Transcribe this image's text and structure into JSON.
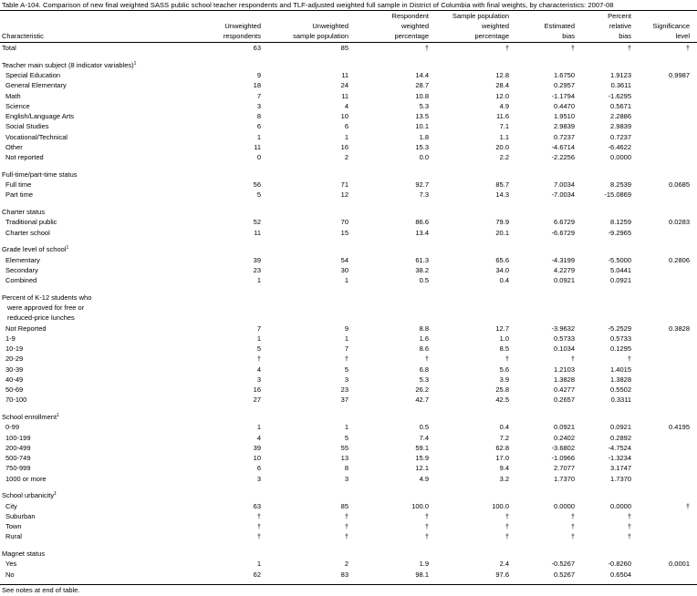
{
  "title": "Table A-104. Comparison of new final weighted SASS public school teacher respondents and TLF-adjusted weighted full sample in District of Columbia with final weights, by characteristics: 2007-08",
  "headers": {
    "characteristic": [
      "Characteristic"
    ],
    "unweighted_respondents": [
      "Unweighted",
      "respondents"
    ],
    "unweighted_sample": [
      "Unweighted",
      "sample population"
    ],
    "respondent_pct": [
      "Respondent",
      "weighted",
      "percentage"
    ],
    "sample_pct": [
      "Sample population",
      "weighted",
      "percentage"
    ],
    "est_bias": [
      "Estimated",
      "bias"
    ],
    "pct_rel_bias": [
      "Percent",
      "relative",
      "bias"
    ],
    "significance": [
      "Significance",
      "level"
    ]
  },
  "rows": [
    {
      "t": "data",
      "label": "Total",
      "indent": 0,
      "v": [
        "63",
        "85",
        "†",
        "†",
        "†",
        "†",
        "†"
      ]
    },
    {
      "t": "gap"
    },
    {
      "t": "section",
      "label": "Teacher main subject (8 indicator variables)",
      "sup": "1"
    },
    {
      "t": "data",
      "label": "Special Education",
      "indent": 1,
      "v": [
        "9",
        "11",
        "14.4",
        "12.8",
        "1.6750",
        "1.9123",
        "0.9987"
      ]
    },
    {
      "t": "data",
      "label": "General Elementary",
      "indent": 1,
      "v": [
        "18",
        "24",
        "28.7",
        "28.4",
        "0.2957",
        "0.3611",
        ""
      ]
    },
    {
      "t": "data",
      "label": "Math",
      "indent": 1,
      "v": [
        "7",
        "11",
        "10.8",
        "12.0",
        "-1.1794",
        "-1.6295",
        ""
      ]
    },
    {
      "t": "data",
      "label": "Science",
      "indent": 1,
      "v": [
        "3",
        "4",
        "5.3",
        "4.9",
        "0.4470",
        "0.5671",
        ""
      ]
    },
    {
      "t": "data",
      "label": "English/Language Arts",
      "indent": 1,
      "v": [
        "8",
        "10",
        "13.5",
        "11.6",
        "1.9510",
        "2.2886",
        ""
      ]
    },
    {
      "t": "data",
      "label": "Social Studies",
      "indent": 1,
      "v": [
        "6",
        "6",
        "10.1",
        "7.1",
        "2.9839",
        "2.9839",
        ""
      ]
    },
    {
      "t": "data",
      "label": "Vocational/Technical",
      "indent": 1,
      "v": [
        "1",
        "1",
        "1.8",
        "1.1",
        "0.7237",
        "0.7237",
        ""
      ]
    },
    {
      "t": "data",
      "label": "Other",
      "indent": 1,
      "v": [
        "11",
        "16",
        "15.3",
        "20.0",
        "-4.6714",
        "-6.4622",
        ""
      ]
    },
    {
      "t": "data",
      "label": "Not reported",
      "indent": 1,
      "v": [
        "0",
        "2",
        "0.0",
        "2.2",
        "-2.2256",
        "0.0000",
        ""
      ]
    },
    {
      "t": "gap"
    },
    {
      "t": "section",
      "label": "Full-time/part-time status"
    },
    {
      "t": "data",
      "label": "Full time",
      "indent": 1,
      "v": [
        "56",
        "71",
        "92.7",
        "85.7",
        "7.0034",
        "8.2539",
        "0.0685"
      ]
    },
    {
      "t": "data",
      "label": "Part time",
      "indent": 1,
      "v": [
        "5",
        "12",
        "7.3",
        "14.3",
        "-7.0034",
        "-15.0869",
        ""
      ]
    },
    {
      "t": "gap"
    },
    {
      "t": "section",
      "label": "Charter status"
    },
    {
      "t": "data",
      "label": "Traditional public",
      "indent": 1,
      "v": [
        "52",
        "70",
        "86.6",
        "79.9",
        "6.6729",
        "8.1259",
        "0.0283"
      ]
    },
    {
      "t": "data",
      "label": "Charter school",
      "indent": 1,
      "v": [
        "11",
        "15",
        "13.4",
        "20.1",
        "-6.6729",
        "-9.2965",
        ""
      ]
    },
    {
      "t": "gap"
    },
    {
      "t": "section",
      "label": "Grade level of school",
      "sup": "1"
    },
    {
      "t": "data",
      "label": "Elementary",
      "indent": 1,
      "v": [
        "39",
        "54",
        "61.3",
        "65.6",
        "-4.3199",
        "-5.5000",
        "0.2806"
      ]
    },
    {
      "t": "data",
      "label": "Secondary",
      "indent": 1,
      "v": [
        "23",
        "30",
        "38.2",
        "34.0",
        "4.2279",
        "5.0441",
        ""
      ]
    },
    {
      "t": "data",
      "label": "Combined",
      "indent": 1,
      "v": [
        "1",
        "1",
        "0.5",
        "0.4",
        "0.0921",
        "0.0921",
        ""
      ]
    },
    {
      "t": "gap"
    },
    {
      "t": "section",
      "label": "Percent of K-12 students who"
    },
    {
      "t": "section",
      "label": "were approved for free or",
      "indent": 2
    },
    {
      "t": "section",
      "label": "reduced-price lunches",
      "indent": 2
    },
    {
      "t": "data",
      "label": "Not Reported",
      "indent": 1,
      "v": [
        "7",
        "9",
        "8.8",
        "12.7",
        "-3.9632",
        "-5.2529",
        "0.3828"
      ]
    },
    {
      "t": "data",
      "label": "1-9",
      "indent": 1,
      "v": [
        "1",
        "1",
        "1.6",
        "1.0",
        "0.5733",
        "0.5733",
        ""
      ]
    },
    {
      "t": "data",
      "label": "10-19",
      "indent": 1,
      "v": [
        "5",
        "7",
        "8.6",
        "8.5",
        "0.1034",
        "0.1295",
        ""
      ]
    },
    {
      "t": "data",
      "label": "20-29",
      "indent": 1,
      "v": [
        "†",
        "†",
        "†",
        "†",
        "†",
        "†",
        ""
      ]
    },
    {
      "t": "data",
      "label": "30-39",
      "indent": 1,
      "v": [
        "4",
        "5",
        "6.8",
        "5.6",
        "1.2103",
        "1.4015",
        ""
      ]
    },
    {
      "t": "data",
      "label": "40-49",
      "indent": 1,
      "v": [
        "3",
        "3",
        "5.3",
        "3.9",
        "1.3828",
        "1.3828",
        ""
      ]
    },
    {
      "t": "data",
      "label": "50-69",
      "indent": 1,
      "v": [
        "16",
        "23",
        "26.2",
        "25.8",
        "0.4277",
        "0.5502",
        ""
      ]
    },
    {
      "t": "data",
      "label": "70-100",
      "indent": 1,
      "v": [
        "27",
        "37",
        "42.7",
        "42.5",
        "0.2657",
        "0.3311",
        ""
      ]
    },
    {
      "t": "gap"
    },
    {
      "t": "section",
      "label": "School enrollment",
      "sup": "1"
    },
    {
      "t": "data",
      "label": "0-99",
      "indent": 1,
      "v": [
        "1",
        "1",
        "0.5",
        "0.4",
        "0.0921",
        "0.0921",
        "0.4195"
      ]
    },
    {
      "t": "data",
      "label": "100-199",
      "indent": 1,
      "v": [
        "4",
        "5",
        "7.4",
        "7.2",
        "0.2402",
        "0.2892",
        ""
      ]
    },
    {
      "t": "data",
      "label": "200-499",
      "indent": 1,
      "v": [
        "39",
        "55",
        "59.1",
        "62.8",
        "-3.6802",
        "-4.7524",
        ""
      ]
    },
    {
      "t": "data",
      "label": "500-749",
      "indent": 1,
      "v": [
        "10",
        "13",
        "15.9",
        "17.0",
        "-1.0966",
        "-1.3234",
        ""
      ]
    },
    {
      "t": "data",
      "label": "750-999",
      "indent": 1,
      "v": [
        "6",
        "8",
        "12.1",
        "9.4",
        "2.7077",
        "3.1747",
        ""
      ]
    },
    {
      "t": "data",
      "label": "1000 or more",
      "indent": 1,
      "v": [
        "3",
        "3",
        "4.9",
        "3.2",
        "1.7370",
        "1.7370",
        ""
      ]
    },
    {
      "t": "gap"
    },
    {
      "t": "section",
      "label": "School urbanicity",
      "sup": "1"
    },
    {
      "t": "data",
      "label": "City",
      "indent": 1,
      "v": [
        "63",
        "85",
        "100.0",
        "100.0",
        "0.0000",
        "0.0000",
        "†"
      ]
    },
    {
      "t": "data",
      "label": "Suburban",
      "indent": 1,
      "v": [
        "†",
        "†",
        "†",
        "†",
        "†",
        "†",
        ""
      ]
    },
    {
      "t": "data",
      "label": "Town",
      "indent": 1,
      "v": [
        "†",
        "†",
        "†",
        "†",
        "†",
        "†",
        ""
      ]
    },
    {
      "t": "data",
      "label": "Rural",
      "indent": 1,
      "v": [
        "†",
        "†",
        "†",
        "†",
        "†",
        "†",
        ""
      ]
    },
    {
      "t": "gap"
    },
    {
      "t": "section",
      "label": "Magnet status"
    },
    {
      "t": "data",
      "label": "Yes",
      "indent": 1,
      "v": [
        "1",
        "2",
        "1.9",
        "2.4",
        "-0.5267",
        "-0.8260",
        "0.0001"
      ]
    },
    {
      "t": "data",
      "label": "No",
      "indent": 1,
      "v": [
        "62",
        "83",
        "98.1",
        "97.6",
        "0.5267",
        "0.6504",
        ""
      ]
    }
  ],
  "footer": "See notes at end of table."
}
